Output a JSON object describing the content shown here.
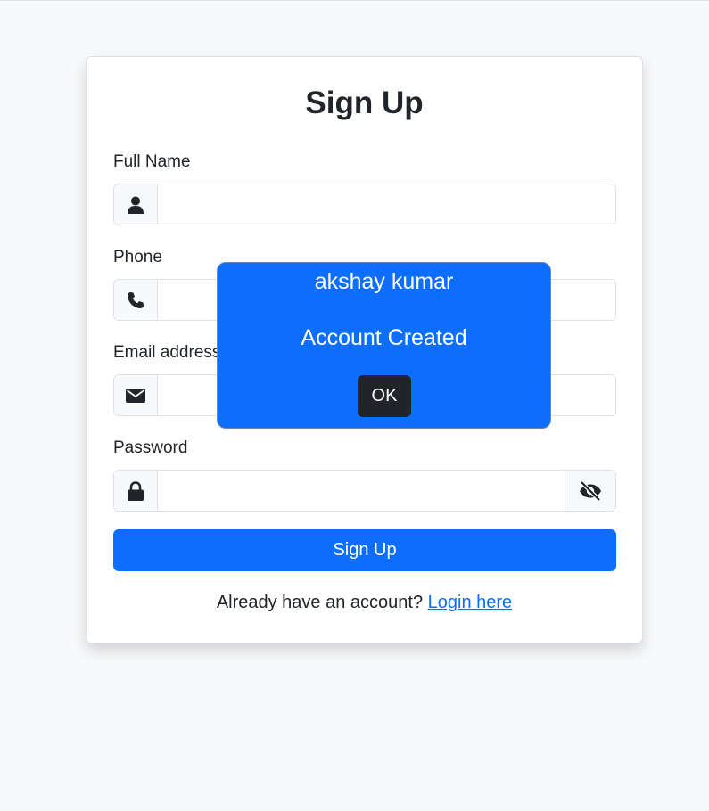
{
  "form": {
    "title": "Sign Up",
    "full_name": {
      "label": "Full Name",
      "value": "",
      "icon": "user-icon"
    },
    "phone": {
      "label": "Phone",
      "value": "",
      "icon": "phone-icon"
    },
    "email": {
      "label": "Email address",
      "value": "",
      "icon": "envelope-icon"
    },
    "password": {
      "label": "Password",
      "value": "",
      "icon": "lock-icon",
      "toggle_icon": "eye-slash-icon"
    },
    "submit_label": "Sign Up",
    "login_prompt": "Already have an account?",
    "login_link": "Login here"
  },
  "popup": {
    "name": "akshay kumar",
    "message": "Account Created",
    "ok_label": "OK"
  },
  "colors": {
    "primary": "#0d6efd",
    "dark": "#212529",
    "background": "#f8f9fa"
  }
}
